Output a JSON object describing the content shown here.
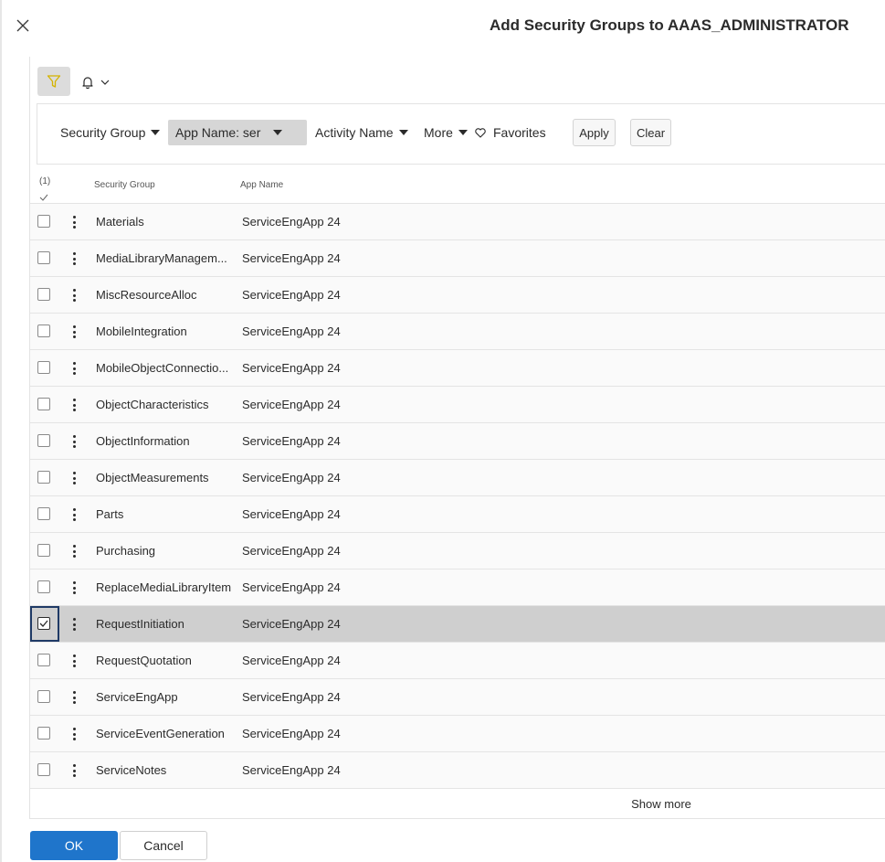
{
  "dialog": {
    "title": "Add Security Groups to AAAS_ADMINISTRATOR",
    "close_icon": "close-icon"
  },
  "toolbar": {
    "filter_icon": "filter-icon",
    "filter_icon_color": "#d4b300",
    "bell_icon": "bell-icon",
    "bell_caret_icon": "chevron-down-icon"
  },
  "filters": {
    "security_group": "Security Group",
    "app_name_chip": "App Name: ser",
    "activity_name": "Activity Name",
    "more": "More",
    "favorites": "Favorites",
    "apply": "Apply",
    "clear": "Clear"
  },
  "table": {
    "selected_count": "(1)",
    "columns": [
      "Security Group",
      "App Name"
    ],
    "rows": [
      {
        "group": "Materials",
        "app": "ServiceEngApp 24",
        "selected": false
      },
      {
        "group": "MediaLibraryManagem...",
        "app": "ServiceEngApp 24",
        "selected": false
      },
      {
        "group": "MiscResourceAlloc",
        "app": "ServiceEngApp 24",
        "selected": false
      },
      {
        "group": "MobileIntegration",
        "app": "ServiceEngApp 24",
        "selected": false
      },
      {
        "group": "MobileObjectConnectio...",
        "app": "ServiceEngApp 24",
        "selected": false
      },
      {
        "group": "ObjectCharacteristics",
        "app": "ServiceEngApp 24",
        "selected": false
      },
      {
        "group": "ObjectInformation",
        "app": "ServiceEngApp 24",
        "selected": false
      },
      {
        "group": "ObjectMeasurements",
        "app": "ServiceEngApp 24",
        "selected": false
      },
      {
        "group": "Parts",
        "app": "ServiceEngApp 24",
        "selected": false
      },
      {
        "group": "Purchasing",
        "app": "ServiceEngApp 24",
        "selected": false
      },
      {
        "group": "ReplaceMediaLibraryItem",
        "app": "ServiceEngApp 24",
        "selected": false
      },
      {
        "group": "RequestInitiation",
        "app": "ServiceEngApp 24",
        "selected": true
      },
      {
        "group": "RequestQuotation",
        "app": "ServiceEngApp 24",
        "selected": false
      },
      {
        "group": "ServiceEngApp",
        "app": "ServiceEngApp 24",
        "selected": false
      },
      {
        "group": "ServiceEventGeneration",
        "app": "ServiceEngApp 24",
        "selected": false
      },
      {
        "group": "ServiceNotes",
        "app": "ServiceEngApp 24",
        "selected": false
      }
    ],
    "show_more": "Show more"
  },
  "footer": {
    "ok": "OK",
    "cancel": "Cancel",
    "ok_color": "#1f75cb"
  }
}
